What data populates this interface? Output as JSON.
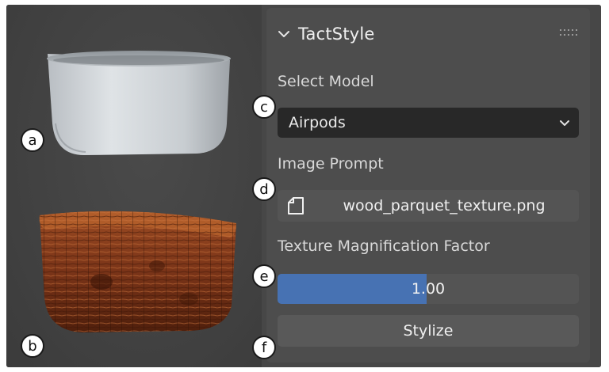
{
  "panel": {
    "title": "TactStyle",
    "model_label": "Select Model",
    "model_value": "Airpods",
    "image_prompt_label": "Image Prompt",
    "image_prompt_file": "wood_parquet_texture.png",
    "magnification_label": "Texture Magnification Factor",
    "magnification_value": "1.00",
    "magnification_fill_fraction": 0.495,
    "stylize_label": "Stylize"
  },
  "callouts": {
    "a": "a",
    "b": "b",
    "c": "c",
    "d": "d",
    "e": "e",
    "f": "f"
  },
  "colors": {
    "slider_fill": "#4772b3",
    "panel_bg": "#474747",
    "dropdown_bg": "#282828"
  },
  "icons": {
    "collapse": "chevron-down-icon",
    "dropdown": "chevron-down-icon",
    "file": "file-icon",
    "grip": "drag-grip-icon"
  }
}
